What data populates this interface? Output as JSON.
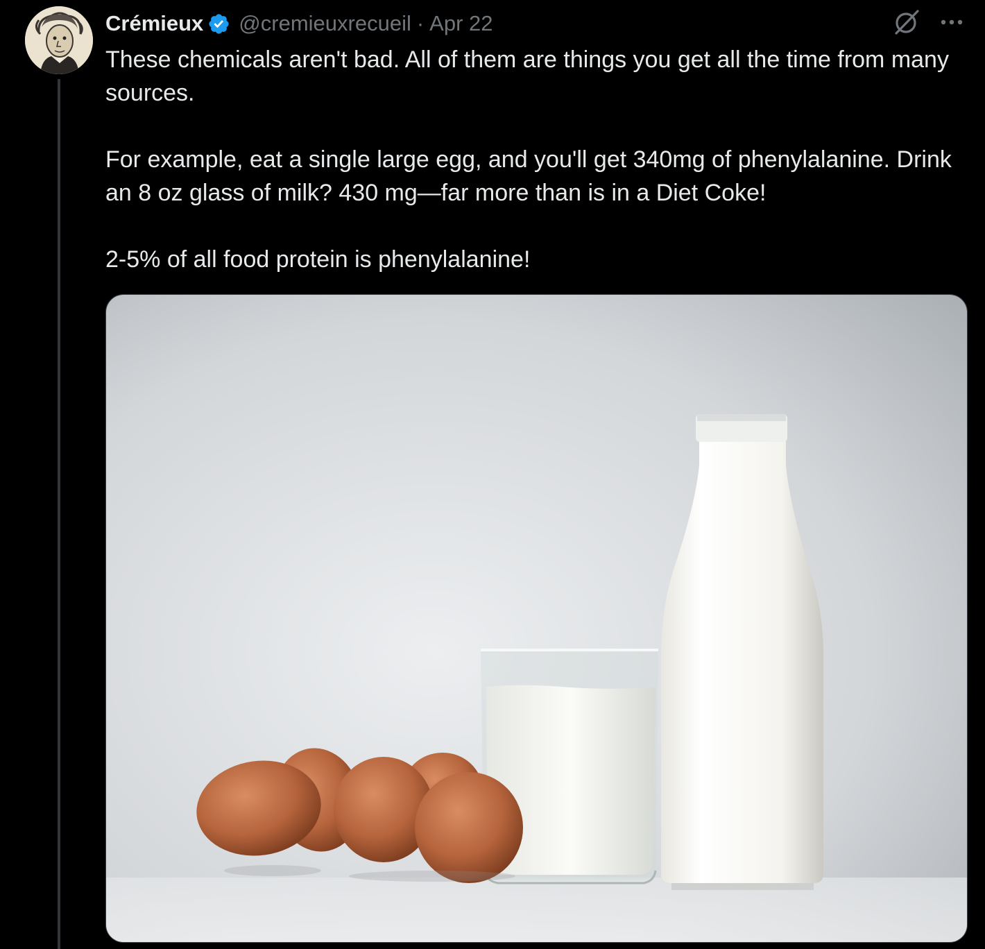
{
  "tweet": {
    "author_name": "Crémieux",
    "handle": "@cremieuxrecueil",
    "separator": "·",
    "date": "Apr 22",
    "verified": true,
    "paragraphs": [
      "These chemicals aren't bad. All of them are things you get all the time from many sources.",
      "For example, eat a single large egg, and you'll get 340mg of phenylalanine. Drink an 8 oz glass of milk? 430 mg—far more than is in a Diet Coke!",
      "2-5% of all food protein is phenylalanine!"
    ]
  },
  "icons": {
    "verified": "verified-badge-icon",
    "grok": "grok-icon",
    "more": "more-options-icon"
  },
  "colors": {
    "background": "#000000",
    "text_primary": "#e7e9ea",
    "text_secondary": "#71767b",
    "verified_blue": "#1d9bf0",
    "thread_line": "#333639"
  },
  "media": {
    "alt": "Brown eggs, a glass of milk and a bottle of milk"
  }
}
